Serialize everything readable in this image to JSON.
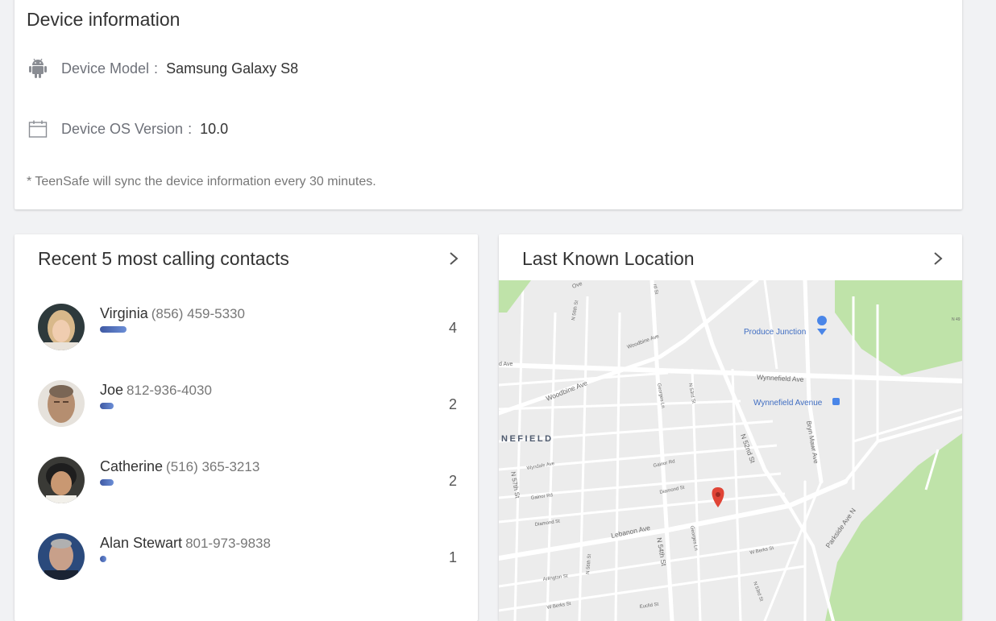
{
  "device_info": {
    "title": "Device information",
    "model_label": "Device Model",
    "model_value": "Samsung Galaxy S8",
    "os_label": "Device OS Version",
    "os_value": "10.0",
    "colon": ":",
    "sync_note": "* TeenSafe will sync the device information every 30 minutes.",
    "icons": {
      "model": "android-icon",
      "os": "calendar-icon"
    }
  },
  "contacts": {
    "title": "Recent 5 most calling contacts",
    "items": [
      {
        "name": "Virginia",
        "phone": "(856) 459-5330",
        "count": "4",
        "bar_fraction": 1.0
      },
      {
        "name": "Joe",
        "phone": "812-936-4030",
        "count": "2",
        "bar_fraction": 0.5
      },
      {
        "name": "Catherine",
        "phone": "(516) 365-3213",
        "count": "2",
        "bar_fraction": 0.5
      },
      {
        "name": "Alan Stewart",
        "phone": "801-973-9838",
        "count": "1",
        "bar_fraction": 0.25
      }
    ]
  },
  "location": {
    "title": "Last Known Location",
    "map": {
      "poi_1": "Produce Junction",
      "poi_2": "Wynnefield Avenue",
      "neighborhood": "NEFIELD",
      "streets": {
        "wynnefield_ave": "Wynnefield Ave",
        "woodbine_ave": "Woodbine Ave",
        "woodbine_ave_2": "Woodbine Ave",
        "lebanon_ave": "Lebanon Ave",
        "n_54th": "N 54th St",
        "n_52nd": "N 52nd St",
        "n_57th": "N 57th St",
        "bryn_mawr": "Bryn Mawr Ave",
        "parkside": "Parkside Ave N",
        "georges_ln": "Georges Ln",
        "georges_ln_2": "Georges Ln",
        "n_53rd": "N 53rd St",
        "n_53rd_2": "N 53rd St",
        "n_56th": "N 56th St",
        "n_56th_2": "N 56th St",
        "w_berks": "W Berks St",
        "diamond": "Diamond St",
        "diamond_2": "Diamond St",
        "gainor": "Gainor Rd",
        "gainor_2": "Gainor Rd",
        "wyndale": "Wyndale Ave",
        "arlington": "Arlington St",
        "berks": "W Berks St",
        "euclid": "Euclid St",
        "ave_edge": "d Ave",
        "over": "Ove",
        "n_st_top": "rd St",
        "n_edge": "N 49"
      }
    }
  }
}
